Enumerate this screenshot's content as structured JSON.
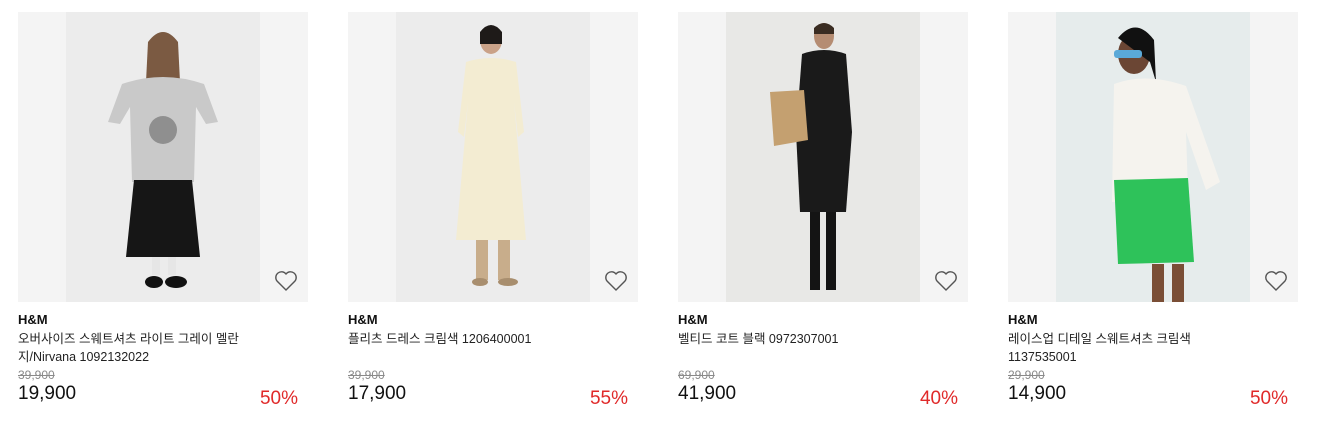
{
  "products": [
    {
      "brand": "H&M",
      "name": "오버사이즈 스웨트셔츠 라이트 그레이 멜란지/Nirvana 1092132022",
      "original_price": "39,900",
      "sale_price": "19,900",
      "discount": "50%",
      "image": "model-grey-sweatshirt-black-skirt"
    },
    {
      "brand": "H&M",
      "name": "플리츠 드레스 크림색 1206400001",
      "original_price": "39,900",
      "sale_price": "17,900",
      "discount": "55%",
      "image": "model-cream-pleated-dress"
    },
    {
      "brand": "H&M",
      "name": "벨티드 코트 블랙 0972307001",
      "original_price": "69,900",
      "sale_price": "41,900",
      "discount": "40%",
      "image": "model-black-belted-coat"
    },
    {
      "brand": "H&M",
      "name": "레이스업 디테일 스웨트셔츠 크림색 1137535001",
      "original_price": "29,900",
      "sale_price": "14,900",
      "discount": "50%",
      "image": "model-cream-laceup-sweatshirt-green-skirt"
    }
  ],
  "icons": {
    "wishlist": "heart-icon"
  },
  "colors": {
    "discount": "#e02a2a",
    "original_price": "#8a8a8a",
    "image_bg": "#f4f4f4"
  }
}
